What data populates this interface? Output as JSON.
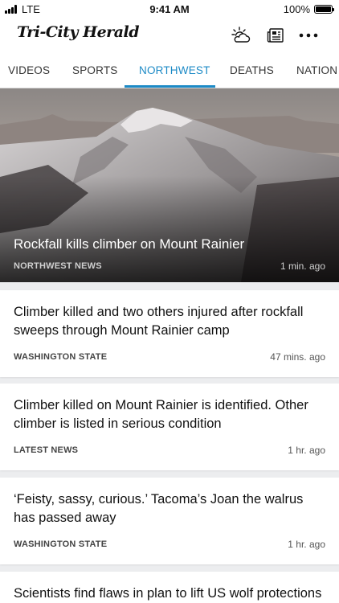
{
  "status_bar": {
    "carrier": "LTE",
    "time": "9:41 AM",
    "battery": "100%"
  },
  "header": {
    "masthead": "Tri-City Herald",
    "icons": [
      "weather-icon",
      "eedition-icon",
      "more-icon"
    ]
  },
  "tabs": {
    "items": [
      "VIDEOS",
      "SPORTS",
      "NORTHWEST",
      "DEATHS",
      "NATION &"
    ],
    "active": "NORTHWEST",
    "accent": "#1c8ac6"
  },
  "hero": {
    "title": "Rockfall kills climber on Mount Rainier",
    "section": "NORTHWEST NEWS",
    "time": "1 min. ago"
  },
  "articles": [
    {
      "title": "Climber killed and two others injured after rockfall sweeps through Mount Rainier camp",
      "section": "WASHINGTON STATE",
      "time": "47 mins. ago"
    },
    {
      "title": "Climber killed on Mount Rainier is identified. Other climber is listed in serious condition",
      "section": "LATEST NEWS",
      "time": "1 hr. ago"
    },
    {
      "title": "‘Feisty, sassy, curious.’ Tacoma’s Joan the walrus has passed away",
      "section": "WASHINGTON STATE",
      "time": "1 hr. ago"
    },
    {
      "title": "Scientists find flaws in plan to lift US wolf protections",
      "section": "",
      "time": ""
    }
  ]
}
